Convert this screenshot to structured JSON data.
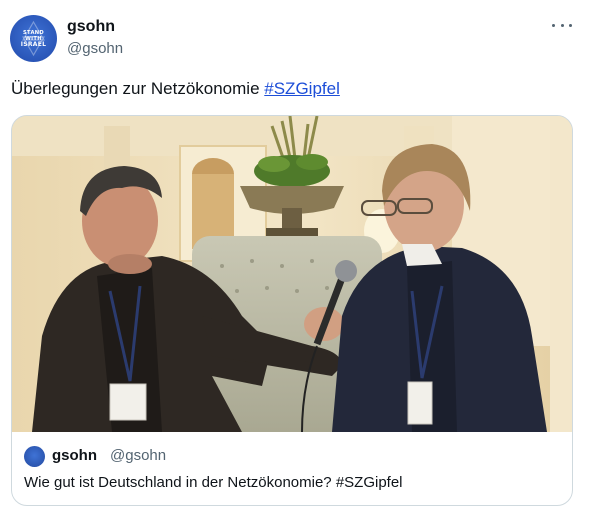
{
  "author": {
    "display_name": "gsohn",
    "handle": "@gsohn",
    "avatar_icon": "stand-with-israel-badge",
    "avatar_text": [
      "STAND",
      "WITH",
      "ISRAEL"
    ]
  },
  "tweet": {
    "text": "Überlegungen zur Netzökonomie ",
    "hashtag": "#SZGipfel"
  },
  "more_icon": "ellipsis-icon",
  "quoted": {
    "media_description_icon": "interview-photo",
    "display_name": "gsohn",
    "handle": "@gsohn",
    "text": "Wie gut ist Deutschland in der Netzökonomie? #SZGipfel"
  },
  "colors": {
    "text": "#0f1419",
    "secondary": "#536471",
    "link": "#1d4ed8",
    "border": "#cfd9de",
    "avatar_blue": "#2a56b8"
  }
}
